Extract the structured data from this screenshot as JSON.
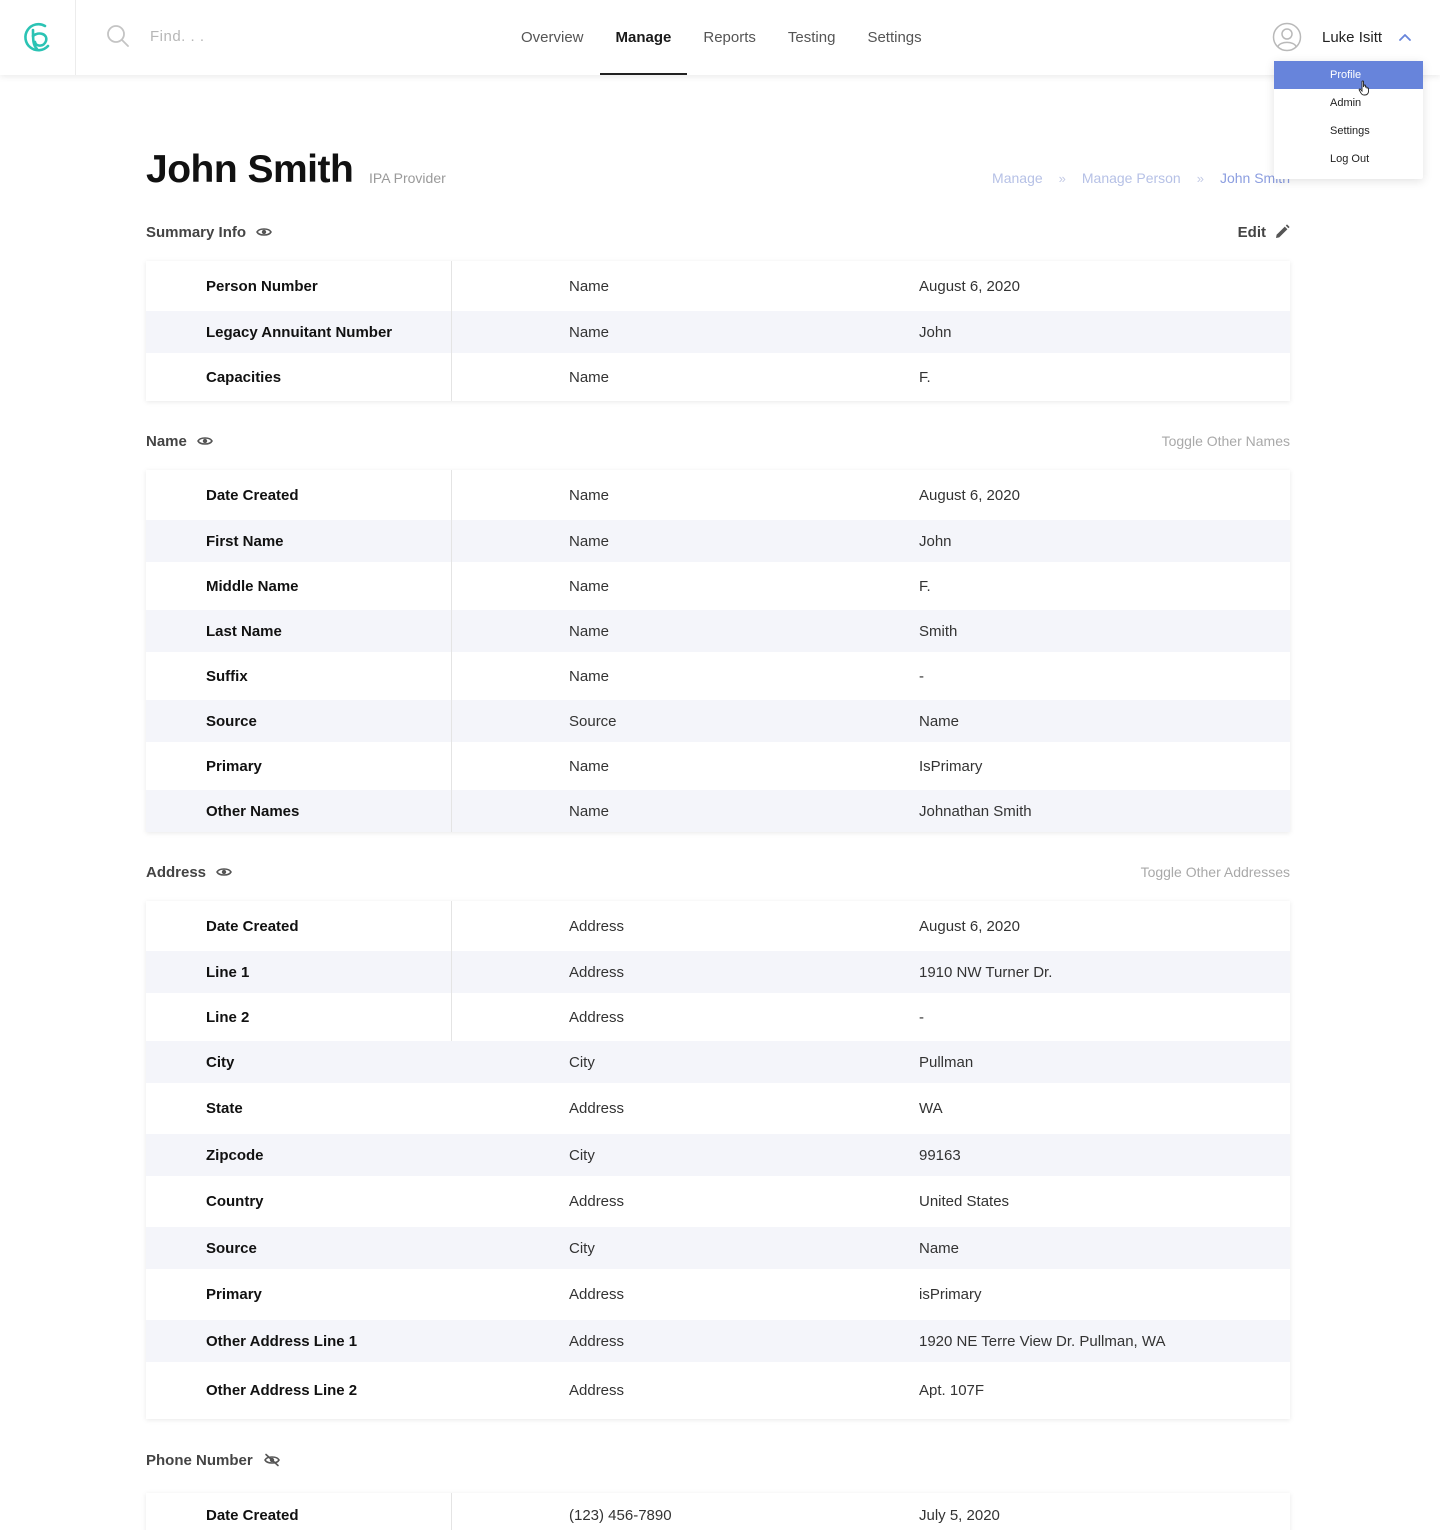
{
  "app": {
    "search_placeholder": "Find. . .",
    "nav": [
      "Overview",
      "Manage",
      "Reports",
      "Testing",
      "Settings"
    ],
    "nav_active": "Manage",
    "user_name": "Luke Isitt",
    "user_menu": [
      "Profile",
      "Admin",
      "Settings",
      "Log Out"
    ],
    "user_menu_active": "Profile",
    "accent_color": "#6784db",
    "logo_color": "#2bc3b4"
  },
  "page": {
    "title": "John Smith",
    "subtitle": "IPA Provider",
    "breadcrumb": [
      "Manage",
      "Manage Person",
      "John Smith"
    ]
  },
  "summary": {
    "title": "Summary Info",
    "action": "Edit",
    "rows": [
      {
        "label": "Person Number",
        "mid": "Name",
        "value": "August 6, 2020"
      },
      {
        "label": "Legacy Annuitant Number",
        "mid": "Name",
        "value": "John"
      },
      {
        "label": "Capacities",
        "mid": "Name",
        "value": "F."
      }
    ]
  },
  "name": {
    "title": "Name",
    "action": "Toggle Other Names",
    "rows": [
      {
        "label": "Date Created",
        "mid": "Name",
        "value": "August 6, 2020"
      },
      {
        "label": "First Name",
        "mid": "Name",
        "value": "John"
      },
      {
        "label": "Middle Name",
        "mid": "Name",
        "value": "F."
      },
      {
        "label": "Last Name",
        "mid": "Name",
        "value": "Smith"
      },
      {
        "label": "Suffix",
        "mid": "Name",
        "value": "-"
      },
      {
        "label": "Source",
        "mid": "Source",
        "value": "Name"
      },
      {
        "label": "Primary",
        "mid": "Name",
        "value": "IsPrimary"
      },
      {
        "label": "Other Names",
        "mid": "Name",
        "value": "Johnathan Smith"
      }
    ]
  },
  "address": {
    "title": "Address",
    "action": "Toggle Other Addresses",
    "rows": [
      {
        "label": "Date Created",
        "mid": "Address",
        "value": "August 6, 2020"
      },
      {
        "label": "Line 1",
        "mid": "Address",
        "value": "1910 NW Turner Dr."
      },
      {
        "label": "Line 2",
        "mid": "Address",
        "value": "-"
      },
      {
        "label": "City",
        "mid": "City",
        "value": "Pullman"
      },
      {
        "label": "State",
        "mid": "Address",
        "value": "WA"
      },
      {
        "label": "Zipcode",
        "mid": "City",
        "value": "99163"
      },
      {
        "label": "Country",
        "mid": "Address",
        "value": "United States"
      },
      {
        "label": "Source",
        "mid": "City",
        "value": "Name"
      },
      {
        "label": "Primary",
        "mid": "Address",
        "value": "isPrimary"
      },
      {
        "label": "Other Address Line 1",
        "mid": "Address",
        "value": "1920 NE Terre View Dr. Pullman, WA"
      },
      {
        "label": "Other Address Line 2",
        "mid": "Address",
        "value": "Apt. 107F"
      }
    ]
  },
  "phone": {
    "title": "Phone Number",
    "rows": [
      {
        "label": "Date Created",
        "mid": "(123) 456-7890",
        "value": "July 5, 2020"
      }
    ]
  }
}
